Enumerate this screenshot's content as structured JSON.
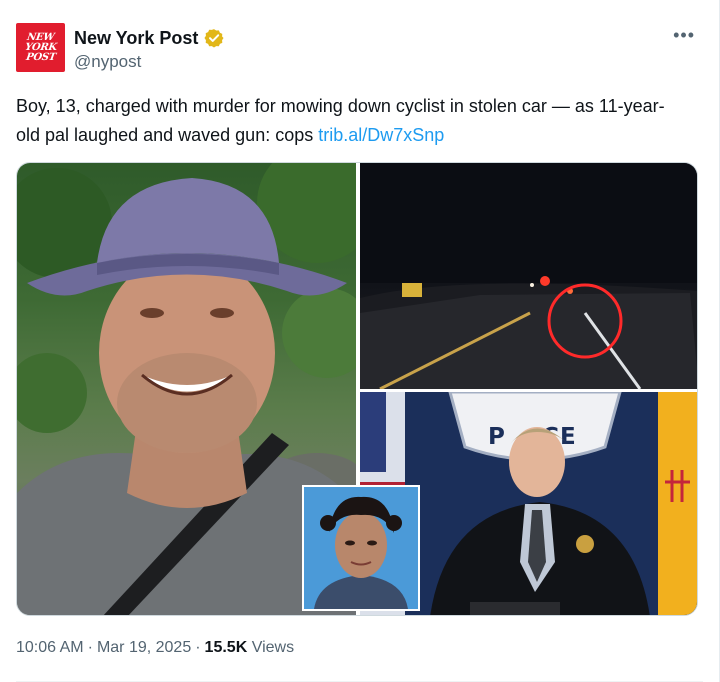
{
  "header": {
    "avatar_text": [
      "NEW",
      "YORK",
      "POST"
    ],
    "display_name": "New York Post",
    "handle": "@nypost",
    "more_icon": "more-icon"
  },
  "tweet": {
    "text": "Boy, 13, charged with murder for mowing down cyclist in stolen car — as 11-year-old pal laughed and waved gun: cops ",
    "link": "trib.al/Dw7xSnp"
  },
  "media": {
    "images": [
      "man-in-hat-selfie-photo",
      "night-road-dashcam-photo",
      "police-press-conference-photo",
      "mugshot-inset-photo"
    ],
    "police_sign_text": "P  CE"
  },
  "footer": {
    "time": "10:06 AM",
    "date": "Mar 19, 2025",
    "views_count": "15.5K",
    "views_label": "Views",
    "separator": "·"
  },
  "colors": {
    "brand_red": "#e11d2e",
    "link_blue": "#1d9bf0",
    "verified_gold": "#e2b719",
    "muted": "#536471"
  }
}
